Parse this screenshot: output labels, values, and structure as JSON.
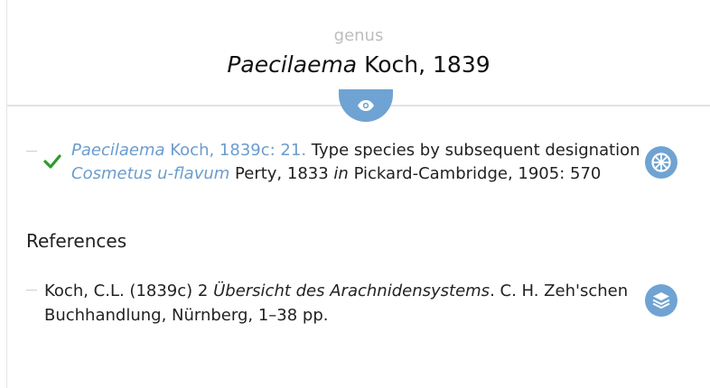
{
  "header": {
    "rank": "genus",
    "genus_name": "Paecilaema",
    "author": "Koch, 1839"
  },
  "type_designation": {
    "citation_genus": "Paecilaema",
    "citation_rest": "Koch, 1839c: 21.",
    "text": "Type species by subsequent designation",
    "species_name": "Cosmetus u-flavum",
    "species_author": "Perty, 1833",
    "in_word": "in",
    "designation_source": "Pickard-Cambridge, 1905: 570"
  },
  "references": {
    "title": "References",
    "items": [
      {
        "prefix": "Koch, C.L. (1839c) 2",
        "title": "Übersicht des Arachnidensystems",
        "suffix": ". C. H. Zeh'schen Buchhandlung, Nürnberg, 1–38 pp."
      }
    ]
  },
  "icons": {
    "eye": "eye-icon",
    "check": "check-icon",
    "taxonomy": "wheel-icon",
    "references": "layers-icon"
  },
  "colors": {
    "accent": "#6fa3d3",
    "link": "#6b9ccd",
    "check": "#2e9b2e",
    "muted": "#bdbdbd"
  }
}
